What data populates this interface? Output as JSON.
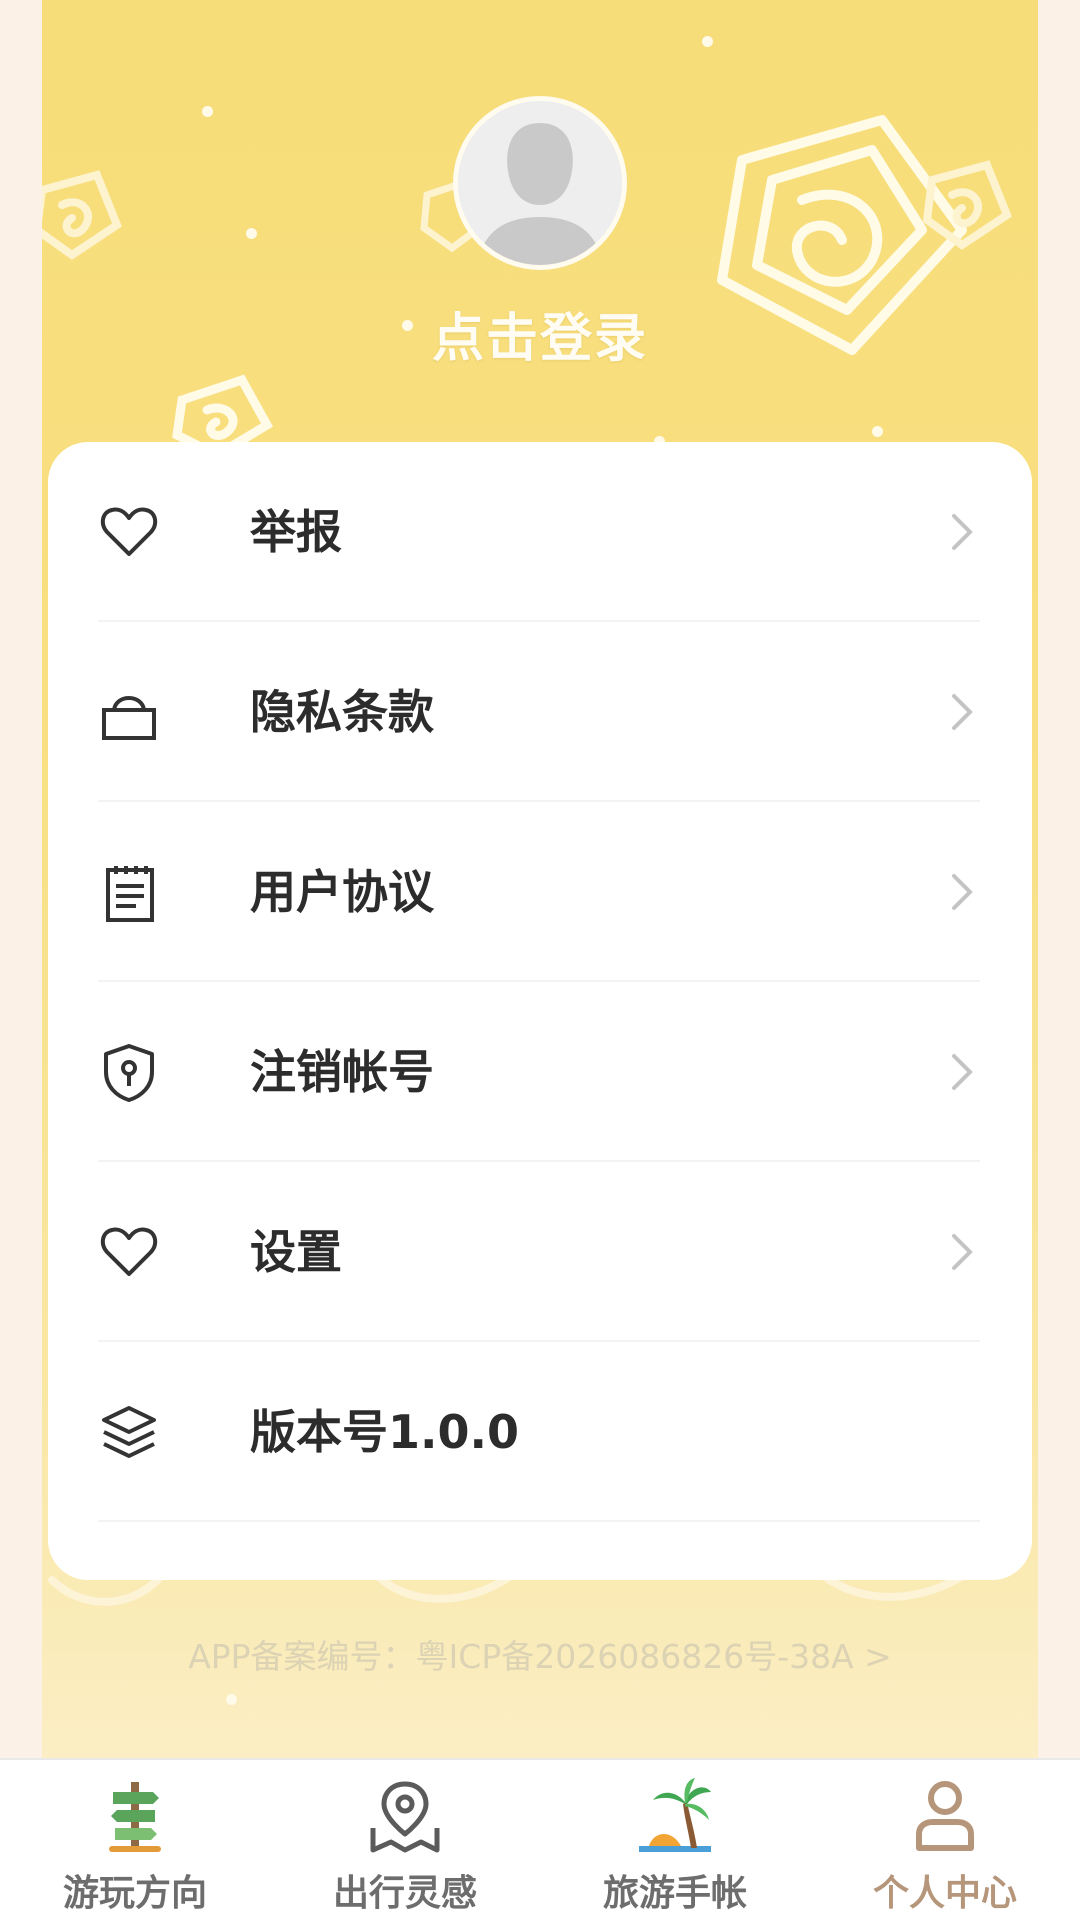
{
  "profile": {
    "login_text": "点击登录"
  },
  "menu": [
    {
      "label": "举报",
      "icon": "heart-icon",
      "has_arrow": true
    },
    {
      "label": "隐私条款",
      "icon": "lock-icon",
      "has_arrow": true
    },
    {
      "label": "用户协议",
      "icon": "document-icon",
      "has_arrow": true
    },
    {
      "label": "注销帐号",
      "icon": "shield-icon",
      "has_arrow": true
    },
    {
      "label": "设置",
      "icon": "heart-icon",
      "has_arrow": true
    },
    {
      "label": "版本号1.0.0",
      "icon": "layers-icon",
      "has_arrow": false
    }
  ],
  "footer": {
    "icp_text": "APP备案编号：粤ICP备2026086826号-38A >"
  },
  "tabbar": {
    "tabs": [
      {
        "label": "游玩方向",
        "icon": "signpost-icon",
        "active": false
      },
      {
        "label": "出行灵感",
        "icon": "map-pin-icon",
        "active": false
      },
      {
        "label": "旅游手帐",
        "icon": "palm-tree-icon",
        "active": false
      },
      {
        "label": "个人中心",
        "icon": "person-icon",
        "active": true
      }
    ]
  },
  "colors": {
    "header_yellow": "#f7dd79",
    "active_tab": "#b6967a",
    "inactive_tab": "#6d6d6d",
    "menu_text": "#2c2c2c"
  }
}
